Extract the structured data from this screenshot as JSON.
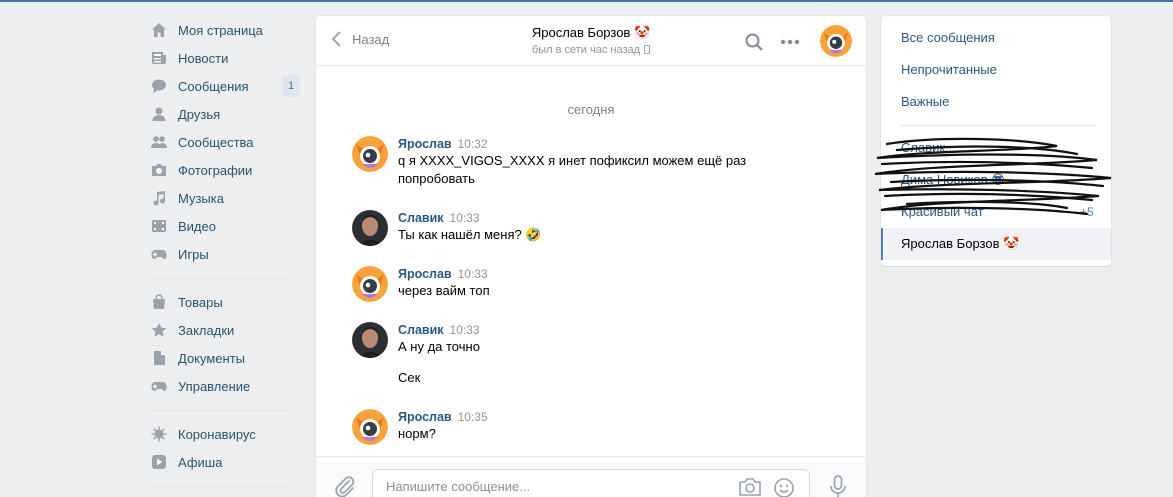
{
  "nav": {
    "items": [
      {
        "label": "Моя страница",
        "icon": "home-icon"
      },
      {
        "label": "Новости",
        "icon": "news-icon"
      },
      {
        "label": "Сообщения",
        "icon": "messages-icon",
        "badge": "1"
      },
      {
        "label": "Друзья",
        "icon": "friend-icon"
      },
      {
        "label": "Сообщества",
        "icon": "groups-icon"
      },
      {
        "label": "Фотографии",
        "icon": "camera-icon"
      },
      {
        "label": "Музыка",
        "icon": "music-icon"
      },
      {
        "label": "Видео",
        "icon": "video-icon"
      },
      {
        "label": "Игры",
        "icon": "gamepad-icon"
      }
    ],
    "items2": [
      {
        "label": "Товары",
        "icon": "bag-icon"
      },
      {
        "label": "Закладки",
        "icon": "star-icon"
      },
      {
        "label": "Документы",
        "icon": "document-icon"
      },
      {
        "label": "Управление",
        "icon": "gamepad-icon"
      }
    ],
    "items3": [
      {
        "label": "Коронавирус",
        "icon": "virus-icon"
      },
      {
        "label": "Афиша",
        "icon": "play-icon"
      }
    ]
  },
  "chat": {
    "back_label": "Назад",
    "title": "Ярослав Борзов 🤡",
    "status": "был в сети час назад",
    "day_label": "сегодня",
    "messages": [
      {
        "author": "Ярослав",
        "time": "10:32",
        "text": "q я XXXX_VIGOS_XXXX я инет пофиксил можем ещё раз попробовать",
        "avatar": "fox"
      },
      {
        "author": "Славик",
        "time": "10:33",
        "text": "Ты как нашёл меня? 🤣",
        "avatar": "man"
      },
      {
        "author": "Ярослав",
        "time": "10:33",
        "text": "через вайм топ",
        "avatar": "fox"
      },
      {
        "author": "Славик",
        "time": "10:33",
        "text": "А ну да точно",
        "text2": "Сек",
        "avatar": "man"
      },
      {
        "author": "Ярослав",
        "time": "10:35",
        "text": "норм?",
        "avatar": "fox"
      }
    ],
    "input_placeholder": "Напишите сообщение..."
  },
  "right": {
    "filters": [
      "Все сообщения",
      "Непрочитанные",
      "Важные"
    ],
    "hidden_items": [
      "Славик...",
      "Дима Новиков 😎",
      "Красивый чат"
    ],
    "hidden_count": "+5",
    "active_chat": "Ярослав Борзов 🤡"
  },
  "colors": {
    "accent": "#4a76a8",
    "link": "#2a5885",
    "background": "#edeef0"
  }
}
